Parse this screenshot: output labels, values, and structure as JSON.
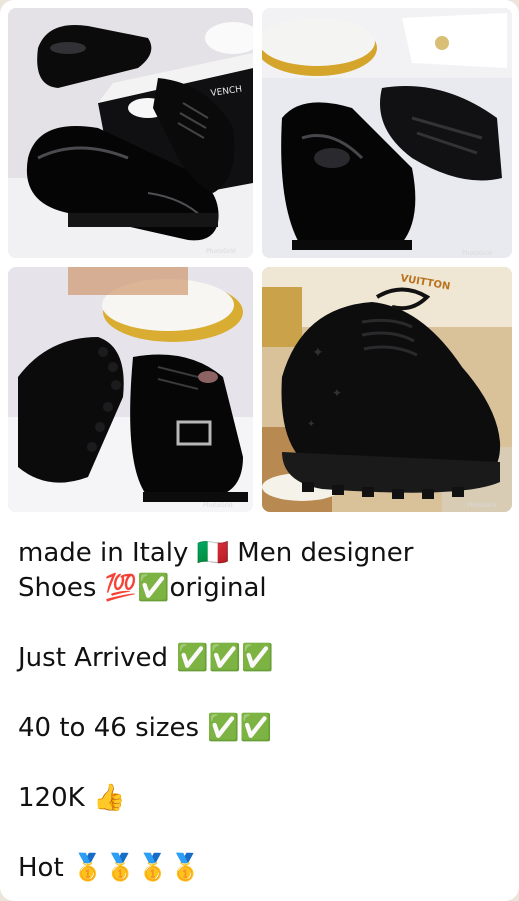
{
  "message": {
    "photos": [
      {
        "watermark": "PhotoGrid",
        "box_text": "VENCH"
      },
      {
        "watermark": "PhotoGrid"
      },
      {
        "watermark": "PhotoGrid"
      },
      {
        "watermark": "PhotoGrid",
        "box_text": "VUITTON"
      }
    ],
    "caption": {
      "line1": "made in Italy 🇮🇹 Men designer",
      "line2": "Shoes 💯✅original",
      "line3": "Just Arrived ✅✅✅",
      "line4": "40 to 46 sizes ✅✅",
      "line5": "120K 👍",
      "line6": "Hot 🥇🥇🥇🥇"
    }
  }
}
